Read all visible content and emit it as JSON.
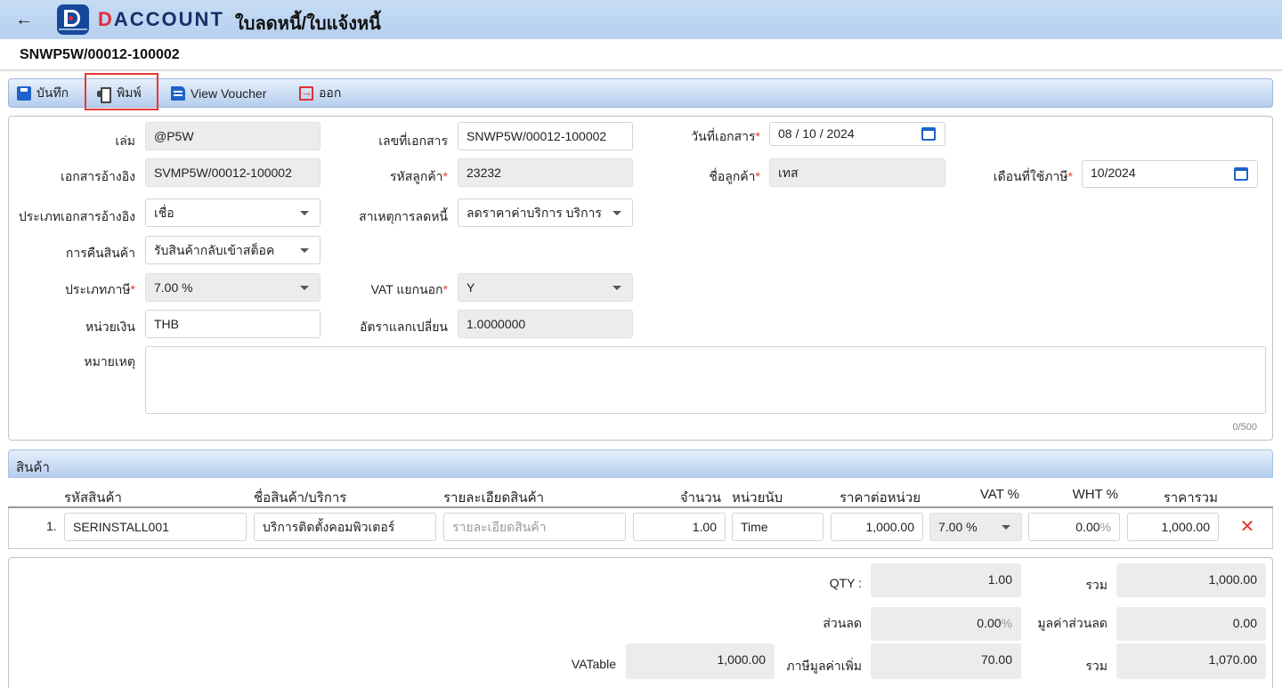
{
  "header": {
    "brand_first": "D",
    "brand_rest": "ACCOUNT",
    "title": "ใบลดหนี้/ใบแจ้งหนี้"
  },
  "document_number": "SNWP5W/00012-100002",
  "toolbar": {
    "save": "บันทึก",
    "print": "พิมพ์",
    "voucher": "View Voucher",
    "exit": "ออก"
  },
  "form": {
    "book": {
      "label": "เล่ม",
      "value": "@P5W"
    },
    "ref_doc": {
      "label": "เอกสารอ้างอิง",
      "value": "SVMP5W/00012-100002"
    },
    "ref_type": {
      "label": "ประเภทเอกสารอ้างอิง",
      "value": "เชื่อ"
    },
    "return_goods": {
      "label": "การคืนสินค้า",
      "value": "รับสินค้ากลับเข้าสต็อค"
    },
    "tax_type": {
      "label": "ประเภทภาษี",
      "value": "7.00 %"
    },
    "currency": {
      "label": "หน่วยเงิน",
      "value": "THB"
    },
    "remark": {
      "label": "หมายเหตุ",
      "counter": "0/500"
    },
    "doc_no": {
      "label": "เลขที่เอกสาร",
      "value": "SNWP5W/00012-100002"
    },
    "customer_code": {
      "label": "รหัสลูกค้า",
      "value": "23232"
    },
    "reason": {
      "label": "สาเหตุการลดหนี้",
      "value": "ลดราคาค่าบริการ บริการ"
    },
    "vat_separate": {
      "label": "VAT แยกนอก",
      "value": "Y"
    },
    "exchange_rate": {
      "label": "อัตราแลกเปลี่ยน",
      "value": "1.0000000"
    },
    "doc_date": {
      "label": "วันที่เอกสาร",
      "value": "08 / 10 /  2024"
    },
    "customer_name": {
      "label": "ชื่อลูกค้า",
      "value": "เทส"
    },
    "tax_month": {
      "label": "เดือนที่ใช้ภาษี",
      "value": "10/2024"
    },
    "required_mark": "*"
  },
  "products": {
    "section_title": "สินค้า",
    "columns": [
      "รหัสสินค้า",
      "ชื่อสินค้า/บริการ",
      "รายละเอียดสินค้า",
      "จำนวน",
      "หน่วยนับ",
      "ราคาต่อหน่วย",
      "VAT %",
      "WHT %",
      "ราคารวม"
    ],
    "rows": [
      {
        "no": "1.",
        "code": "SERINSTALL001",
        "name": "บริการติดตั้งคอมพิวเตอร์",
        "detail_placeholder": "รายละเอียดสินค้า",
        "qty": "1.00",
        "unit": "Time",
        "unit_price": "1,000.00",
        "vat": "7.00 %",
        "wht": "0.00",
        "wht_pct": "%",
        "total": "1,000.00"
      }
    ]
  },
  "totals": {
    "qty_label": "QTY :",
    "qty_value": "1.00",
    "discount_label": "ส่วนลด",
    "discount_value": "0.00",
    "discount_pct": "%",
    "vatable_label": "VATable",
    "vatable_value": "1,000.00",
    "vat_label": "ภาษีมูลค่าเพิ่ม",
    "vat_value": "70.00",
    "sum_label": "รวม",
    "sum_value": "1,000.00",
    "discount_amount_label": "มูลค่าส่วนลด",
    "discount_amount_value": "0.00",
    "grand_label": "รวม",
    "grand_value": "1,070.00"
  },
  "colors": {
    "brand_blue": "#16489a",
    "accent_red": "#e32b3c",
    "icon_blue": "#1d63c9"
  }
}
